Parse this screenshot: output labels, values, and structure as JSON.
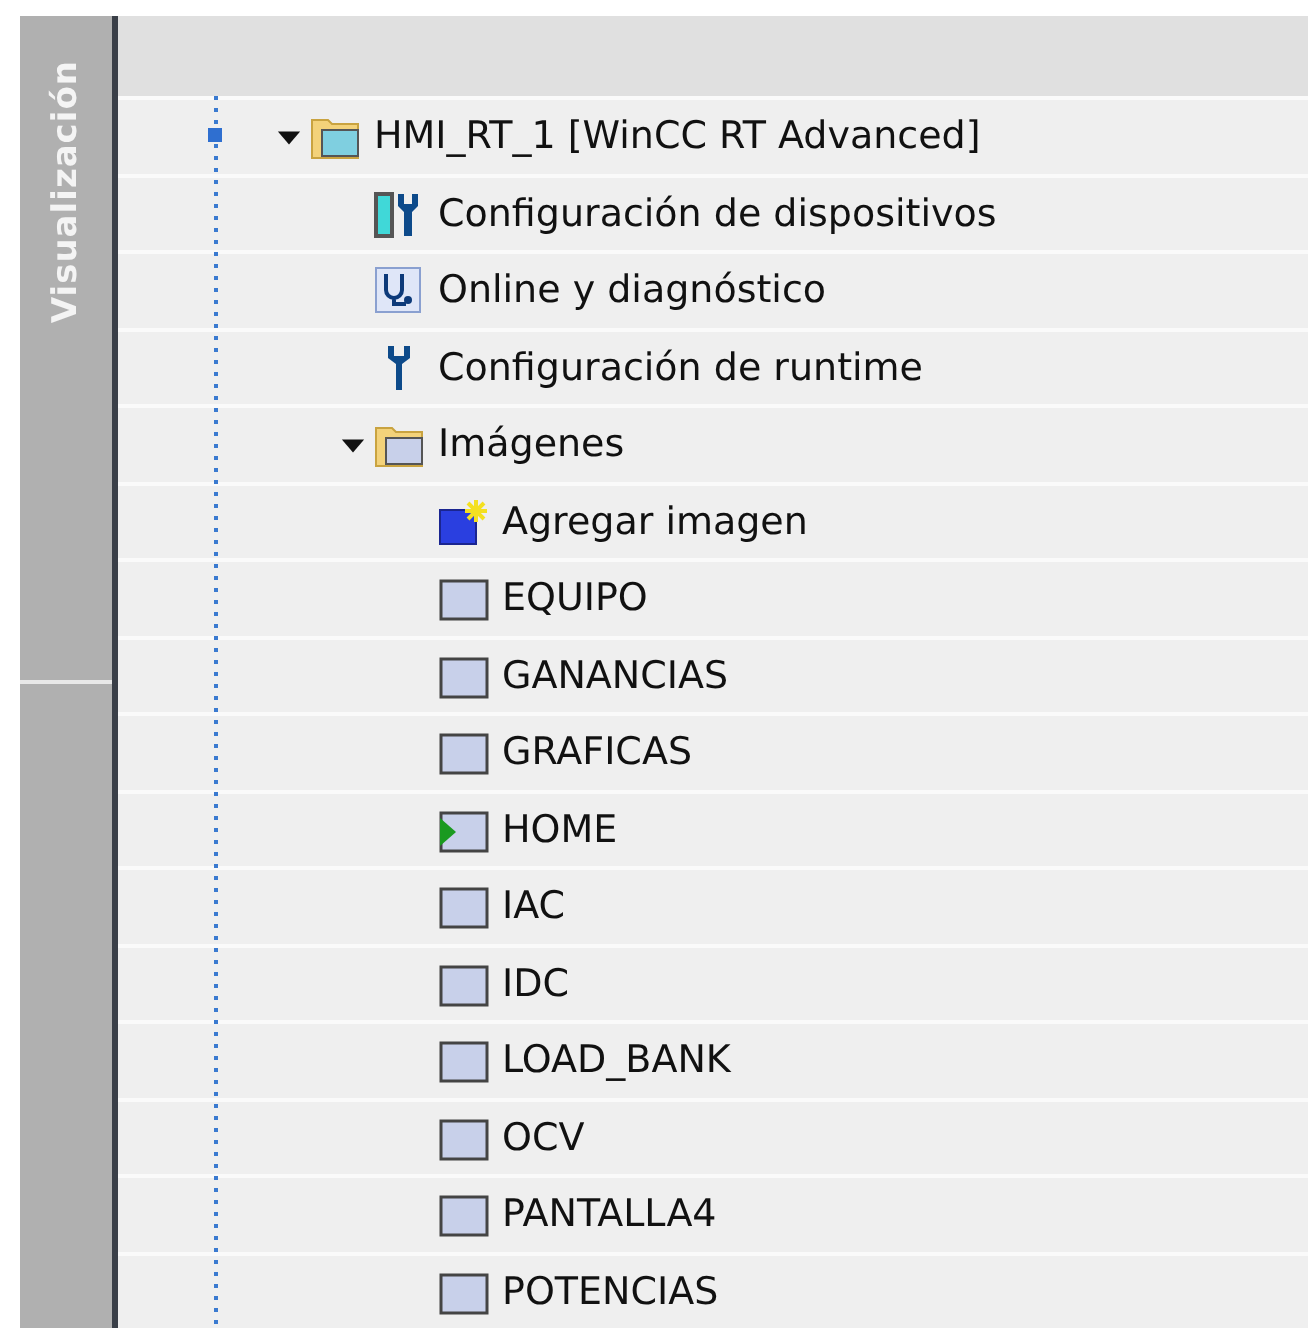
{
  "sidebar": {
    "label": "Visualización"
  },
  "tree": [
    {
      "label": "HMI_RT_1 [WinCC RT Advanced]",
      "kind": "device",
      "expanded": true,
      "children": [
        {
          "label": "Configuración de dispositivos",
          "kind": "device-config"
        },
        {
          "label": "Online y diagnóstico",
          "kind": "diagnostics"
        },
        {
          "label": "Configuración de runtime",
          "kind": "runtime-config"
        },
        {
          "label": "Imágenes",
          "kind": "folder",
          "expanded": true,
          "children": [
            {
              "label": "Agregar imagen",
              "kind": "add-screen"
            },
            {
              "label": "EQUIPO",
              "kind": "screen"
            },
            {
              "label": "GANANCIAS",
              "kind": "screen"
            },
            {
              "label": "GRAFICAS",
              "kind": "screen"
            },
            {
              "label": "HOME",
              "kind": "start-screen"
            },
            {
              "label": "IAC",
              "kind": "screen"
            },
            {
              "label": "IDC",
              "kind": "screen"
            },
            {
              "label": "LOAD_BANK",
              "kind": "screen"
            },
            {
              "label": "OCV",
              "kind": "screen"
            },
            {
              "label": "PANTALLA4",
              "kind": "screen"
            },
            {
              "label": "POTENCIAS",
              "kind": "screen"
            }
          ]
        }
      ]
    }
  ]
}
